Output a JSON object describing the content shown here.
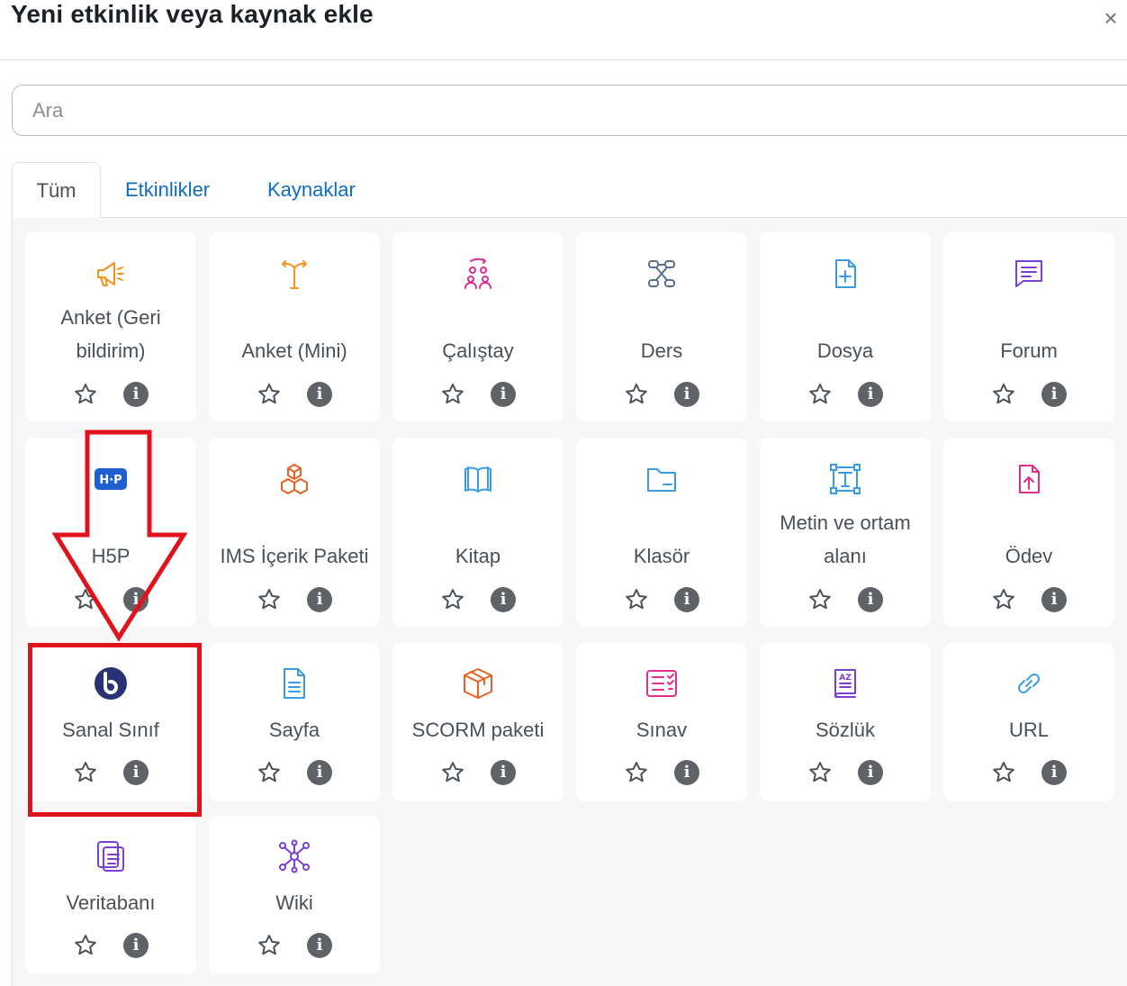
{
  "dialog": {
    "title": "Yeni etkinlik veya kaynak ekle",
    "close_symbol": "×"
  },
  "search": {
    "placeholder": "Ara",
    "value": ""
  },
  "tabs": [
    {
      "label": "Tüm",
      "active": true
    },
    {
      "label": "Etkinlikler",
      "active": false
    },
    {
      "label": "Kaynaklar",
      "active": false
    }
  ],
  "modules": [
    {
      "lines": [
        "Anket (Geri",
        "bildirim)"
      ],
      "icon": "megaphone-icon",
      "color": "#f7931e"
    },
    {
      "lines": [
        "Anket (Mini)"
      ],
      "icon": "signpost-icon",
      "color": "#f7931e"
    },
    {
      "lines": [
        "Çalıştay"
      ],
      "icon": "workshop-icon",
      "color": "#e12d8c"
    },
    {
      "lines": [
        "Ders"
      ],
      "icon": "lesson-flow-icon",
      "color": "#5c6e8f"
    },
    {
      "lines": [
        "Dosya"
      ],
      "icon": "file-icon",
      "color": "#399be2"
    },
    {
      "lines": [
        "Forum"
      ],
      "icon": "forum-icon",
      "color": "#7b3fd1"
    },
    {
      "lines": [
        "H5P"
      ],
      "icon": "h5p-icon",
      "color": "#1f5fd2"
    },
    {
      "lines": [
        "IMS İçerik Paketi"
      ],
      "icon": "cubes-icon",
      "color": "#e76125"
    },
    {
      "lines": [
        "Kitap"
      ],
      "icon": "book-icon",
      "color": "#399be2"
    },
    {
      "lines": [
        "Klasör"
      ],
      "icon": "folder-icon",
      "color": "#399be2"
    },
    {
      "lines": [
        "Metin ve ortam",
        "alanı"
      ],
      "icon": "text-area-icon",
      "color": "#399be2"
    },
    {
      "lines": [
        "Ödev"
      ],
      "icon": "assignment-upload-icon",
      "color": "#e12d8c"
    },
    {
      "lines": [
        "Sanal Sınıf"
      ],
      "icon": "bigbluebutton-icon",
      "color": "#283274"
    },
    {
      "lines": [
        "Sayfa"
      ],
      "icon": "page-icon",
      "color": "#399be2"
    },
    {
      "lines": [
        "SCORM paketi"
      ],
      "icon": "package-box-icon",
      "color": "#e76125"
    },
    {
      "lines": [
        "Sınav"
      ],
      "icon": "quiz-icon",
      "color": "#e12d8c"
    },
    {
      "lines": [
        "Sözlük"
      ],
      "icon": "glossary-icon",
      "color": "#7b3fd1"
    },
    {
      "lines": [
        "URL"
      ],
      "icon": "link-icon",
      "color": "#399be2"
    },
    {
      "lines": [
        "Veritabanı"
      ],
      "icon": "database-icon",
      "color": "#7b3fd1"
    },
    {
      "lines": [
        "Wiki"
      ],
      "icon": "wiki-network-icon",
      "color": "#7b3fd1"
    }
  ],
  "annotation": {
    "color": "#e0121b",
    "highlighted_module": "Sanal Sınıf"
  }
}
